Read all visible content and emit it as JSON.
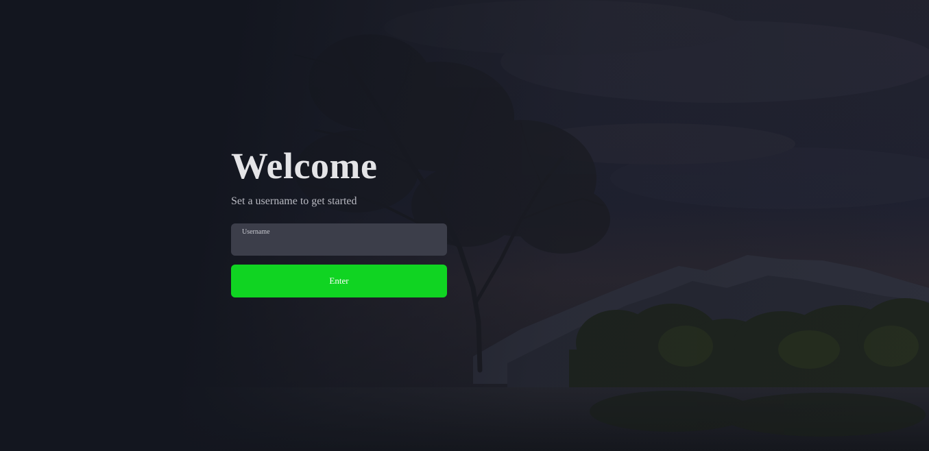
{
  "welcome": {
    "title": "Welcome",
    "subtitle": "Set a username to get started"
  },
  "username_field": {
    "label": "Username",
    "value": "",
    "placeholder": ""
  },
  "enter_button": {
    "label": "Enter"
  },
  "colors": {
    "background": "#13161f",
    "field_background": "#3c3e4a",
    "button_accent": "#10d422",
    "title_text": "#e4e4e7"
  }
}
